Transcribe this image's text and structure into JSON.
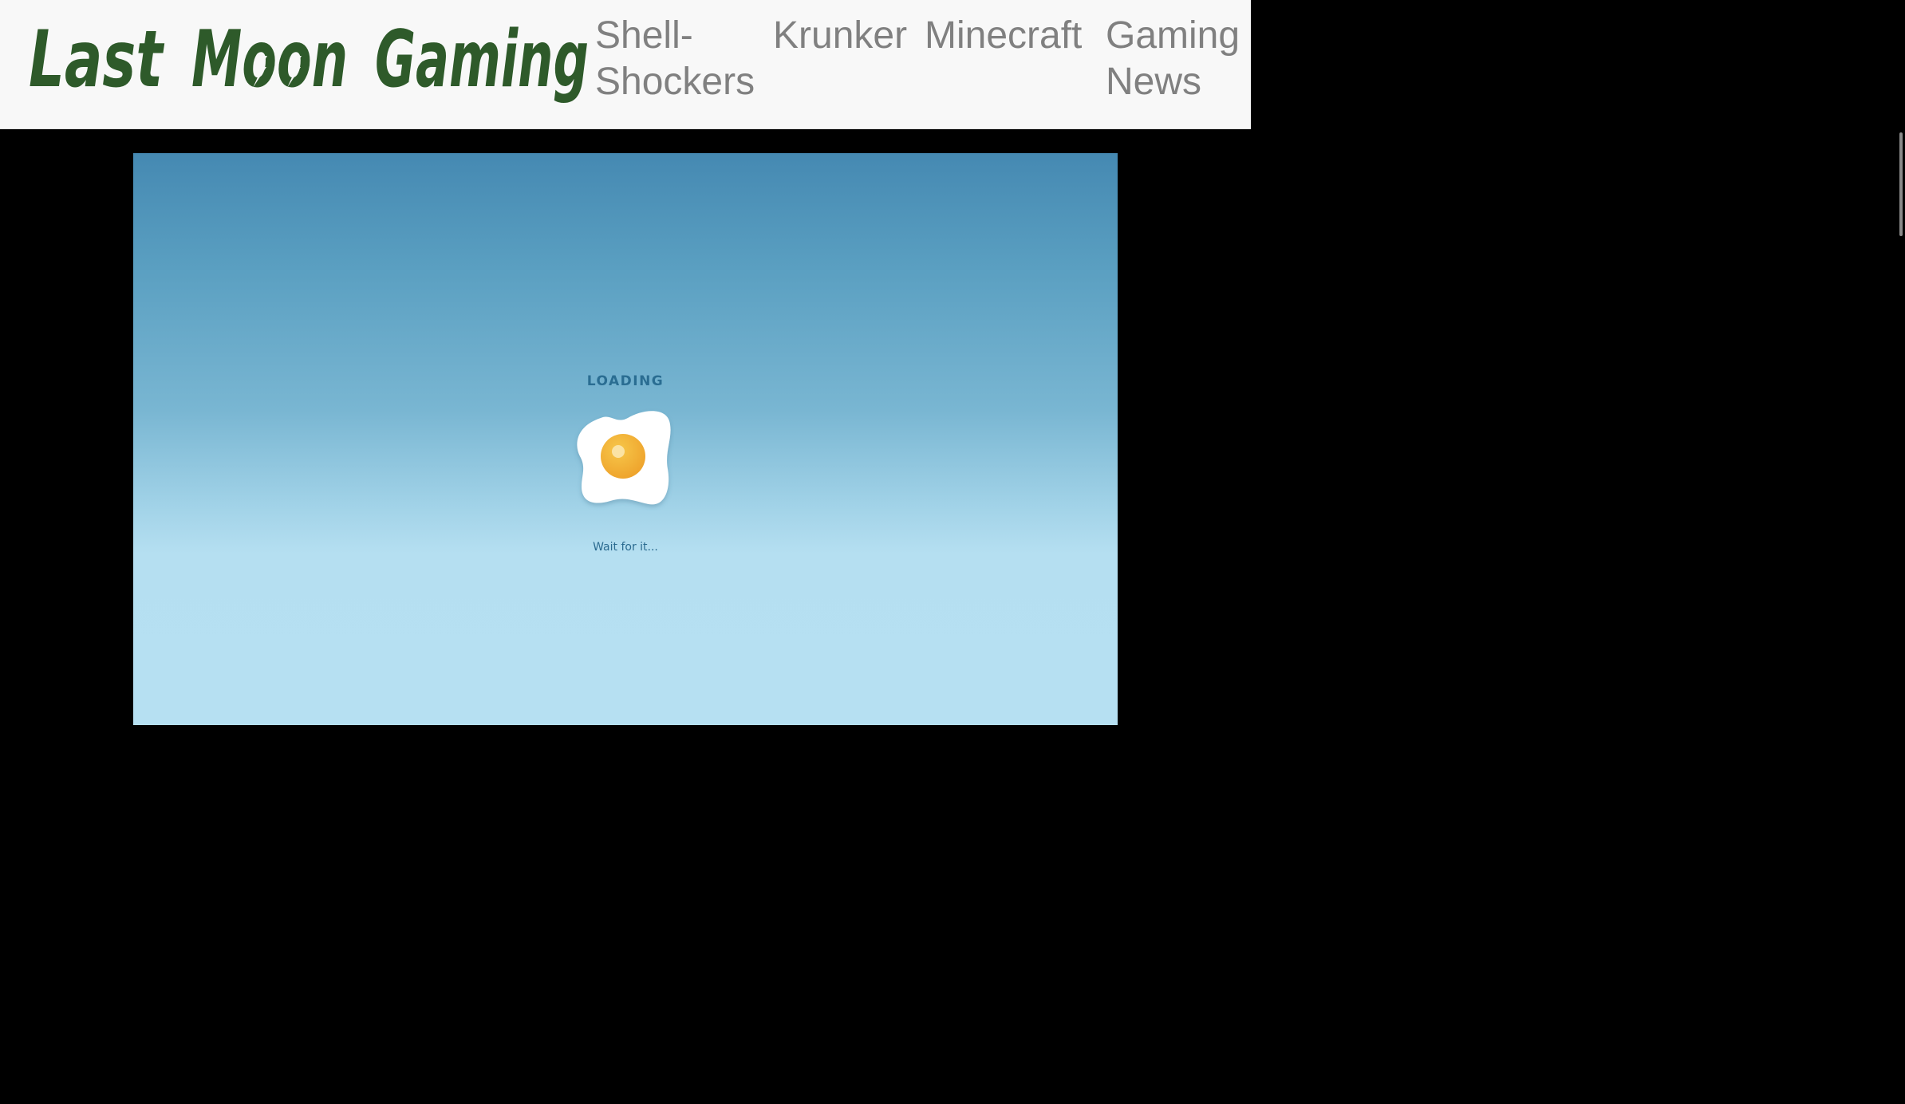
{
  "header": {
    "logo_text": "Last Moon Gaming",
    "logo_color": "#2e5a2a",
    "nav": [
      {
        "label": "Shell-Shockers",
        "display": "Shell-\nShockers"
      },
      {
        "label": "Krunker"
      },
      {
        "label": "Minecraft"
      },
      {
        "label": "Gaming News",
        "display": "Gaming\nNews"
      }
    ],
    "nav_color": "#808080"
  },
  "game": {
    "loading_title": "LOADING",
    "wait_text": "Wait for it...",
    "icon": "fried-egg-icon",
    "colors": {
      "sky_top": "#4589b2",
      "sky_bottom": "#b6e0f2",
      "text": "#2a6d92",
      "yolk": "#f2b134"
    }
  }
}
